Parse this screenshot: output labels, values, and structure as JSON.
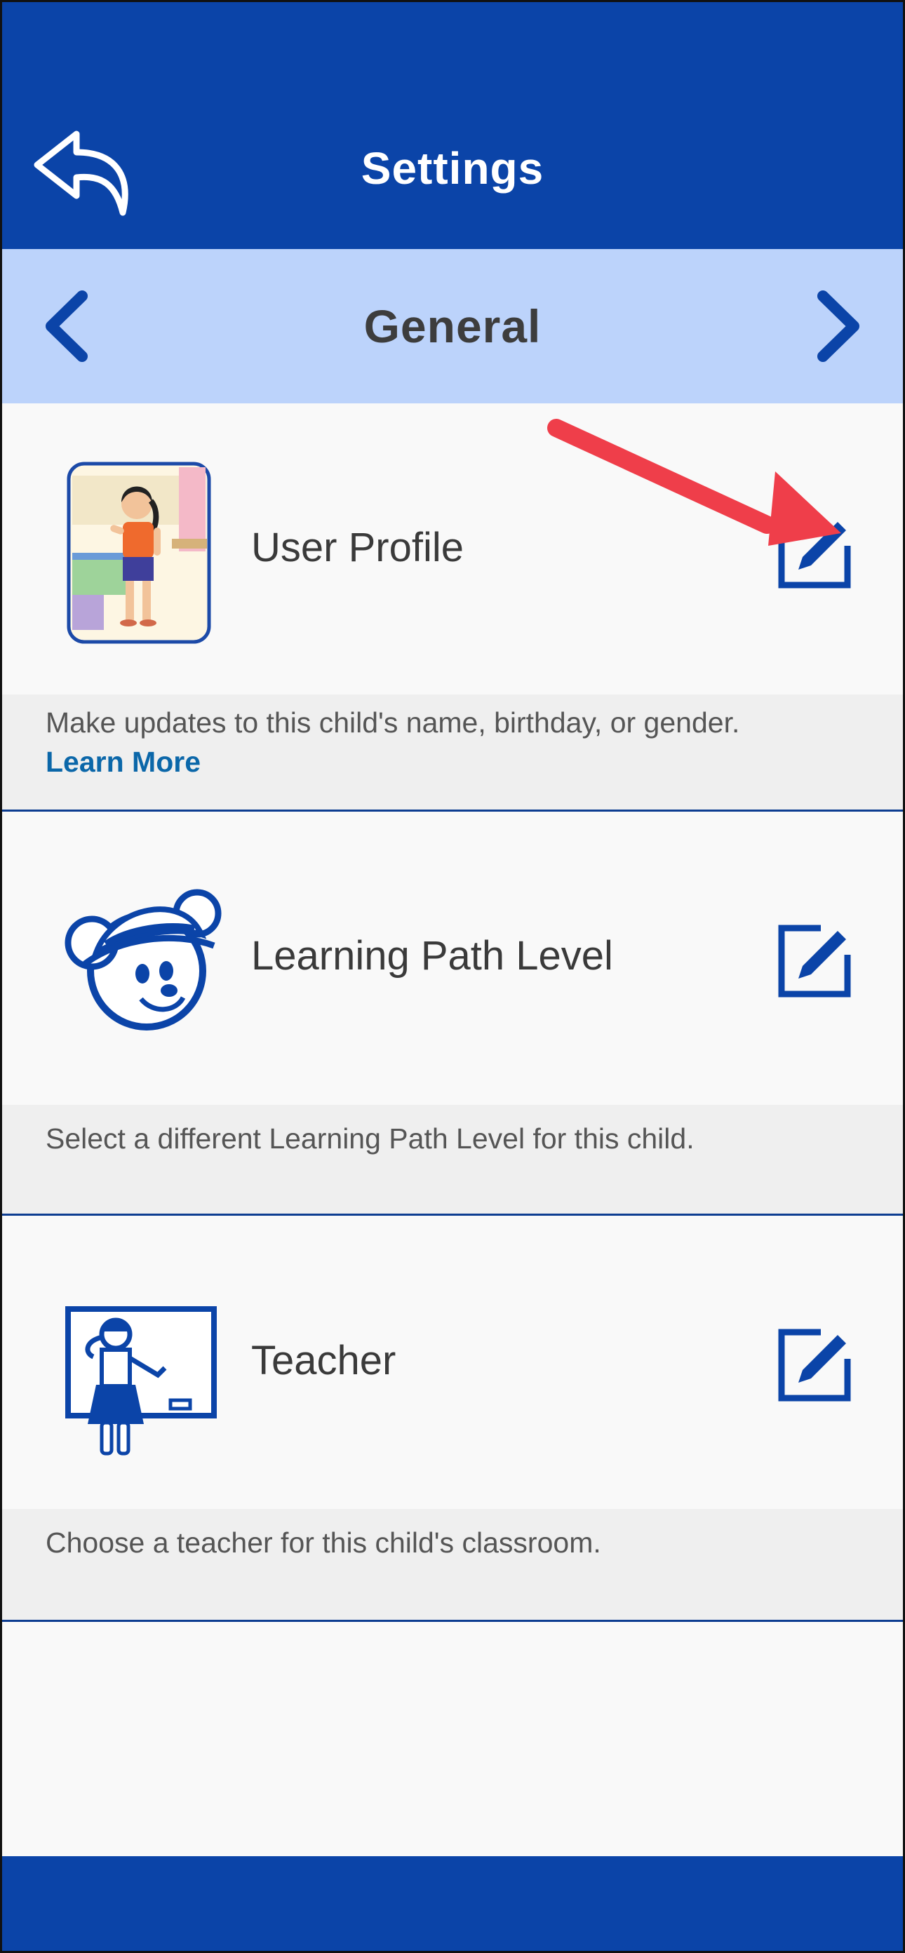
{
  "header": {
    "title": "Settings",
    "back_icon": "back-arrow-icon"
  },
  "section": {
    "title": "General",
    "prev_icon": "chevron-left-icon",
    "next_icon": "chevron-right-icon"
  },
  "settings": [
    {
      "label": "User Profile",
      "description": "Make updates to this child's name, birthday, or gender.",
      "link": "Learn More",
      "icon": "child-avatar-icon",
      "action_icon": "edit-icon"
    },
    {
      "label": "Learning Path Level",
      "description": "Select a different Learning Path Level for this child.",
      "icon": "mouse-mascot-icon",
      "action_icon": "edit-icon"
    },
    {
      "label": "Teacher",
      "description": "Choose a teacher for this child's classroom.",
      "icon": "teacher-icon",
      "action_icon": "edit-icon"
    }
  ],
  "colors": {
    "primary": "#0b44a8",
    "section_bg": "#bcd3fb",
    "link": "#0b67a9",
    "annotation_arrow": "#ef3e4a"
  }
}
